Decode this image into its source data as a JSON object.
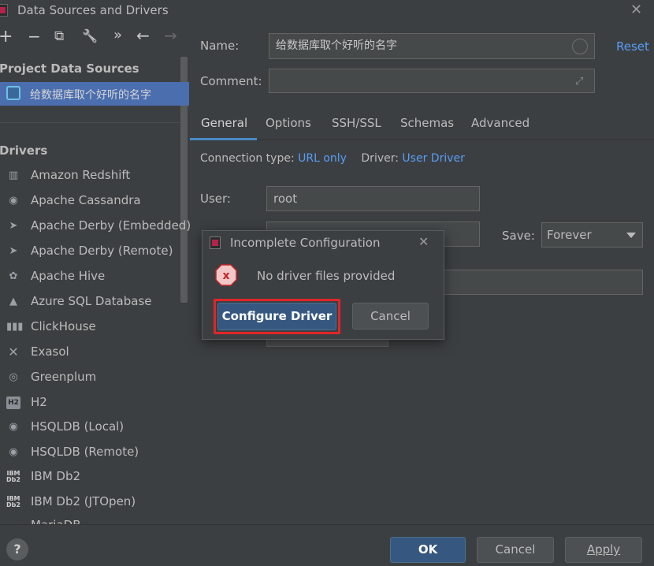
{
  "window": {
    "title": "Data Sources and Drivers"
  },
  "toolbar": {
    "add": "+",
    "remove": "−",
    "copy": "⧉",
    "settings": "🔧",
    "more": "»",
    "back": "←",
    "forward": "→"
  },
  "left": {
    "project_header": "Project Data Sources",
    "project_item": "给数据库取个好听的名字",
    "drivers_header": "Drivers",
    "drivers": [
      {
        "label": "Amazon Redshift",
        "icon": "redshift-icon"
      },
      {
        "label": "Apache Cassandra",
        "icon": "cassandra-icon"
      },
      {
        "label": "Apache Derby (Embedded)",
        "icon": "derby-icon"
      },
      {
        "label": "Apache Derby (Remote)",
        "icon": "derby-icon"
      },
      {
        "label": "Apache Hive",
        "icon": "hive-icon"
      },
      {
        "label": "Azure SQL Database",
        "icon": "azure-icon"
      },
      {
        "label": "ClickHouse",
        "icon": "clickhouse-icon"
      },
      {
        "label": "Exasol",
        "icon": "exasol-icon"
      },
      {
        "label": "Greenplum",
        "icon": "greenplum-icon"
      },
      {
        "label": "H2",
        "icon": "h2-icon"
      },
      {
        "label": "HSQLDB (Local)",
        "icon": "hsqldb-icon"
      },
      {
        "label": "HSQLDB (Remote)",
        "icon": "hsqldb-icon"
      },
      {
        "label": "IBM Db2",
        "icon": "db2-icon"
      },
      {
        "label": "IBM Db2 (JTOpen)",
        "icon": "db2-icon"
      },
      {
        "label": "MariaDB",
        "icon": "mariadb-icon"
      }
    ],
    "h2_badge": "H2",
    "db2_badge": "IBM Db2"
  },
  "form": {
    "name_label": "Name:",
    "name_value": "给数据库取个好听的名字",
    "reset": "Reset",
    "comment_label": "Comment:",
    "comment_value": "",
    "tabs": [
      "General",
      "Options",
      "SSH/SSL",
      "Schemas",
      "Advanced"
    ],
    "conn_type_label": "Connection type:",
    "conn_type_value": "URL only",
    "driver_label": "Driver:",
    "driver_value": "User Driver",
    "user_label": "User:",
    "user_value": "root",
    "save_label": "Save:",
    "save_value": "Forever"
  },
  "dialog": {
    "title": "Incomplete Configuration",
    "message": "No driver files provided",
    "configure": "Configure Driver",
    "cancel": "Cancel",
    "error_glyph": "x"
  },
  "footer": {
    "help": "?",
    "ok": "OK",
    "cancel": "Cancel",
    "apply": "Apply"
  },
  "colors": {
    "accent": "#4b6eaf",
    "link": "#589df6",
    "focus": "#e0262a",
    "error": "#c0252a"
  }
}
